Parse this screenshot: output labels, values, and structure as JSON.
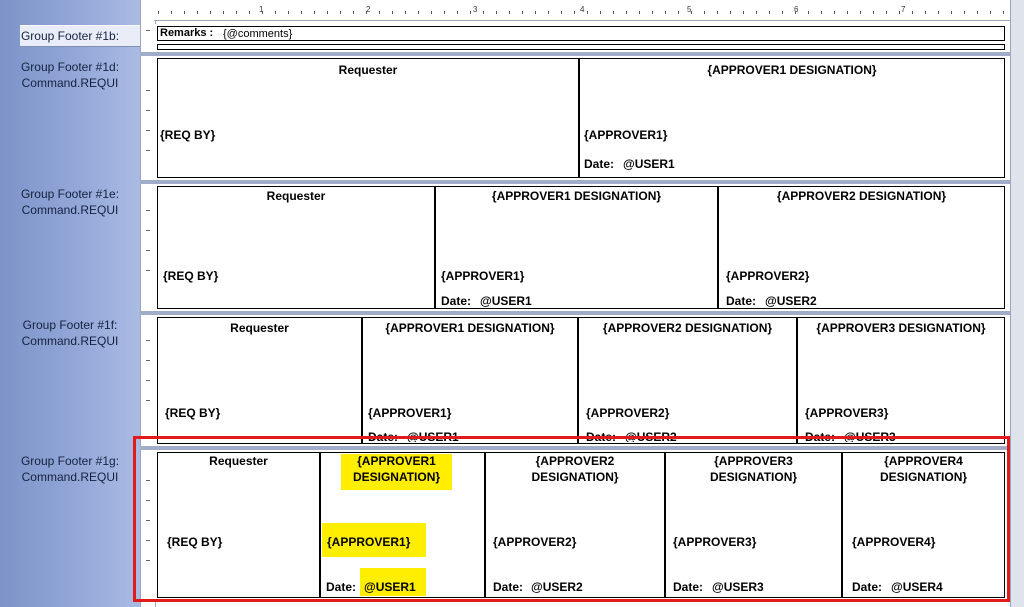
{
  "ruler": {
    "numbers": [
      "1",
      "2",
      "3",
      "4",
      "5",
      "6",
      "7"
    ]
  },
  "sections": [
    {
      "label": "Group Footer #1b:",
      "sublabel": ""
    },
    {
      "label": "Group Footer #1d:",
      "sublabel": "Command.REQUI"
    },
    {
      "label": "Group Footer #1e:",
      "sublabel": "Command.REQUI"
    },
    {
      "label": "Group Footer #1f:",
      "sublabel": "Command.REQUI"
    },
    {
      "label": "Group Footer #1g:",
      "sublabel": "Command.REQUI"
    }
  ],
  "remarks": {
    "label": "Remarks :",
    "field": "{@comments}"
  },
  "fields": {
    "requester": "Requester",
    "req_by": "{REQ BY}",
    "date_label": "Date:",
    "approver1_designation": "{APPROVER1 DESIGNATION}",
    "approver2_designation": "{APPROVER2 DESIGNATION}",
    "approver3_designation": "{APPROVER3 DESIGNATION}",
    "approver1_designation_l1": "{APPROVER1",
    "approver2_designation_l1": "{APPROVER2",
    "approver3_designation_l1": "{APPROVER3",
    "approver4_designation_l1": "{APPROVER4",
    "designation_l2": "DESIGNATION}",
    "approver1": "{APPROVER1}",
    "approver2": "{APPROVER2}",
    "approver3": "{APPROVER3}",
    "approver4": "{APPROVER4}",
    "user1": "@USER1",
    "user2": "@USER2",
    "user3": "@USER3",
    "user4": "@USER4"
  },
  "colors": {
    "highlight": "#ffee00",
    "selection": "#e11b1b",
    "labels_bg": "#8aa0d2"
  }
}
